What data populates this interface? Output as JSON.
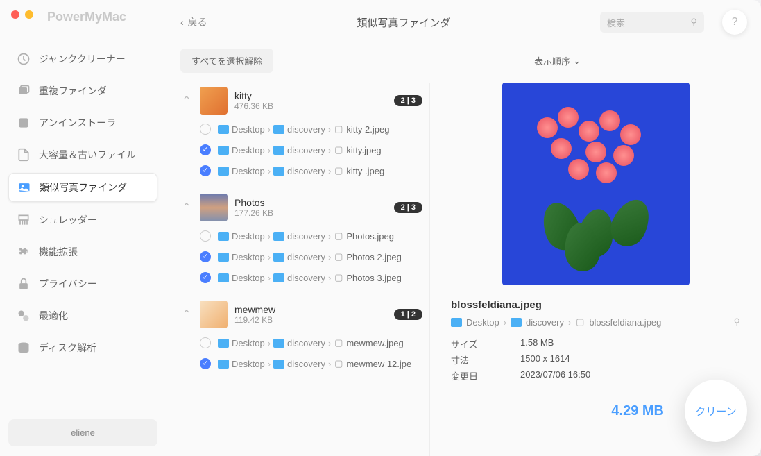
{
  "app_title": "PowerMyMac",
  "back_label": "戻る",
  "page_title": "類似写真ファインダ",
  "search_placeholder": "検索",
  "help_label": "?",
  "deselect_all": "すべてを選択解除",
  "sort_label": "表示順序",
  "sidebar": {
    "items": [
      {
        "label": "ジャンククリーナー"
      },
      {
        "label": "重複ファインダ"
      },
      {
        "label": "アンインストーラ"
      },
      {
        "label": "大容量＆古いファイル"
      },
      {
        "label": "類似写真ファインダ"
      },
      {
        "label": "シュレッダー"
      },
      {
        "label": "機能拡張"
      },
      {
        "label": "プライバシー"
      },
      {
        "label": "最適化"
      },
      {
        "label": "ディスク解析"
      }
    ],
    "user": "eliene"
  },
  "groups": [
    {
      "name": "kitty",
      "size": "476.36 KB",
      "badge": "2 | 3",
      "files": [
        {
          "checked": false,
          "path1": "Desktop",
          "path2": "discovery",
          "filename": "kitty 2.jpeg"
        },
        {
          "checked": true,
          "path1": "Desktop",
          "path2": "discovery",
          "filename": "kitty.jpeg"
        },
        {
          "checked": true,
          "path1": "Desktop",
          "path2": "discovery",
          "filename": "kitty .jpeg"
        }
      ]
    },
    {
      "name": "Photos",
      "size": "177.26 KB",
      "badge": "2 | 3",
      "files": [
        {
          "checked": false,
          "path1": "Desktop",
          "path2": "discovery",
          "filename": "Photos.jpeg"
        },
        {
          "checked": true,
          "path1": "Desktop",
          "path2": "discovery",
          "filename": "Photos 2.jpeg"
        },
        {
          "checked": true,
          "path1": "Desktop",
          "path2": "discovery",
          "filename": "Photos 3.jpeg"
        }
      ]
    },
    {
      "name": "mewmew",
      "size": "119.42 KB",
      "badge": "1 | 2",
      "files": [
        {
          "checked": false,
          "path1": "Desktop",
          "path2": "discovery",
          "filename": "mewmew.jpeg"
        },
        {
          "checked": true,
          "path1": "Desktop",
          "path2": "discovery",
          "filename": "mewmew 12.jpe"
        }
      ]
    }
  ],
  "preview": {
    "name": "blossfeldiana.jpeg",
    "path1": "Desktop",
    "path2": "discovery",
    "filename": "blossfeldiana.jpeg",
    "meta": {
      "size_label": "サイズ",
      "size_value": "1.58 MB",
      "dim_label": "寸法",
      "dim_value": "1500 x 1614",
      "date_label": "変更日",
      "date_value": "2023/07/06 16:50"
    }
  },
  "total_size": "4.29 MB",
  "clean_label": "クリーン"
}
